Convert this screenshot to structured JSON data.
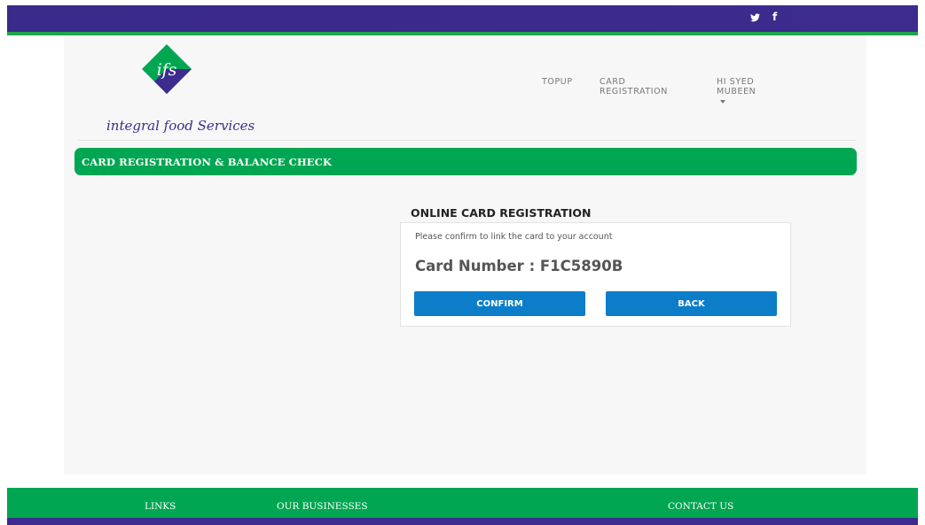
{
  "topbar": {
    "social": [
      {
        "icon": "twitter-icon",
        "glyph": "𝕪"
      },
      {
        "icon": "facebook-icon",
        "glyph": "f"
      }
    ]
  },
  "brand": {
    "logo_mark": "ifs",
    "name": "integral food Services",
    "colors": {
      "green": "#00a651",
      "purple": "#3d2b8e",
      "button_blue": "#0b7dc9"
    }
  },
  "nav": {
    "topup": "TOPUP",
    "card_registration": "CARD REGISTRATION",
    "user": "HI SYED MUBEEN"
  },
  "band": {
    "title": "CARD REGISTRATION & BALANCE CHECK"
  },
  "panel": {
    "heading": "ONLINE CARD REGISTRATION",
    "description": "Please confirm to link the card to your account",
    "card_number": "Card Number : F1C5890B",
    "confirm_label": "CONFIRM",
    "back_label": "BACK"
  },
  "footer": {
    "links": "LINKS",
    "businesses": "OUR BUSINESSES",
    "contact": "CONTACT US"
  }
}
